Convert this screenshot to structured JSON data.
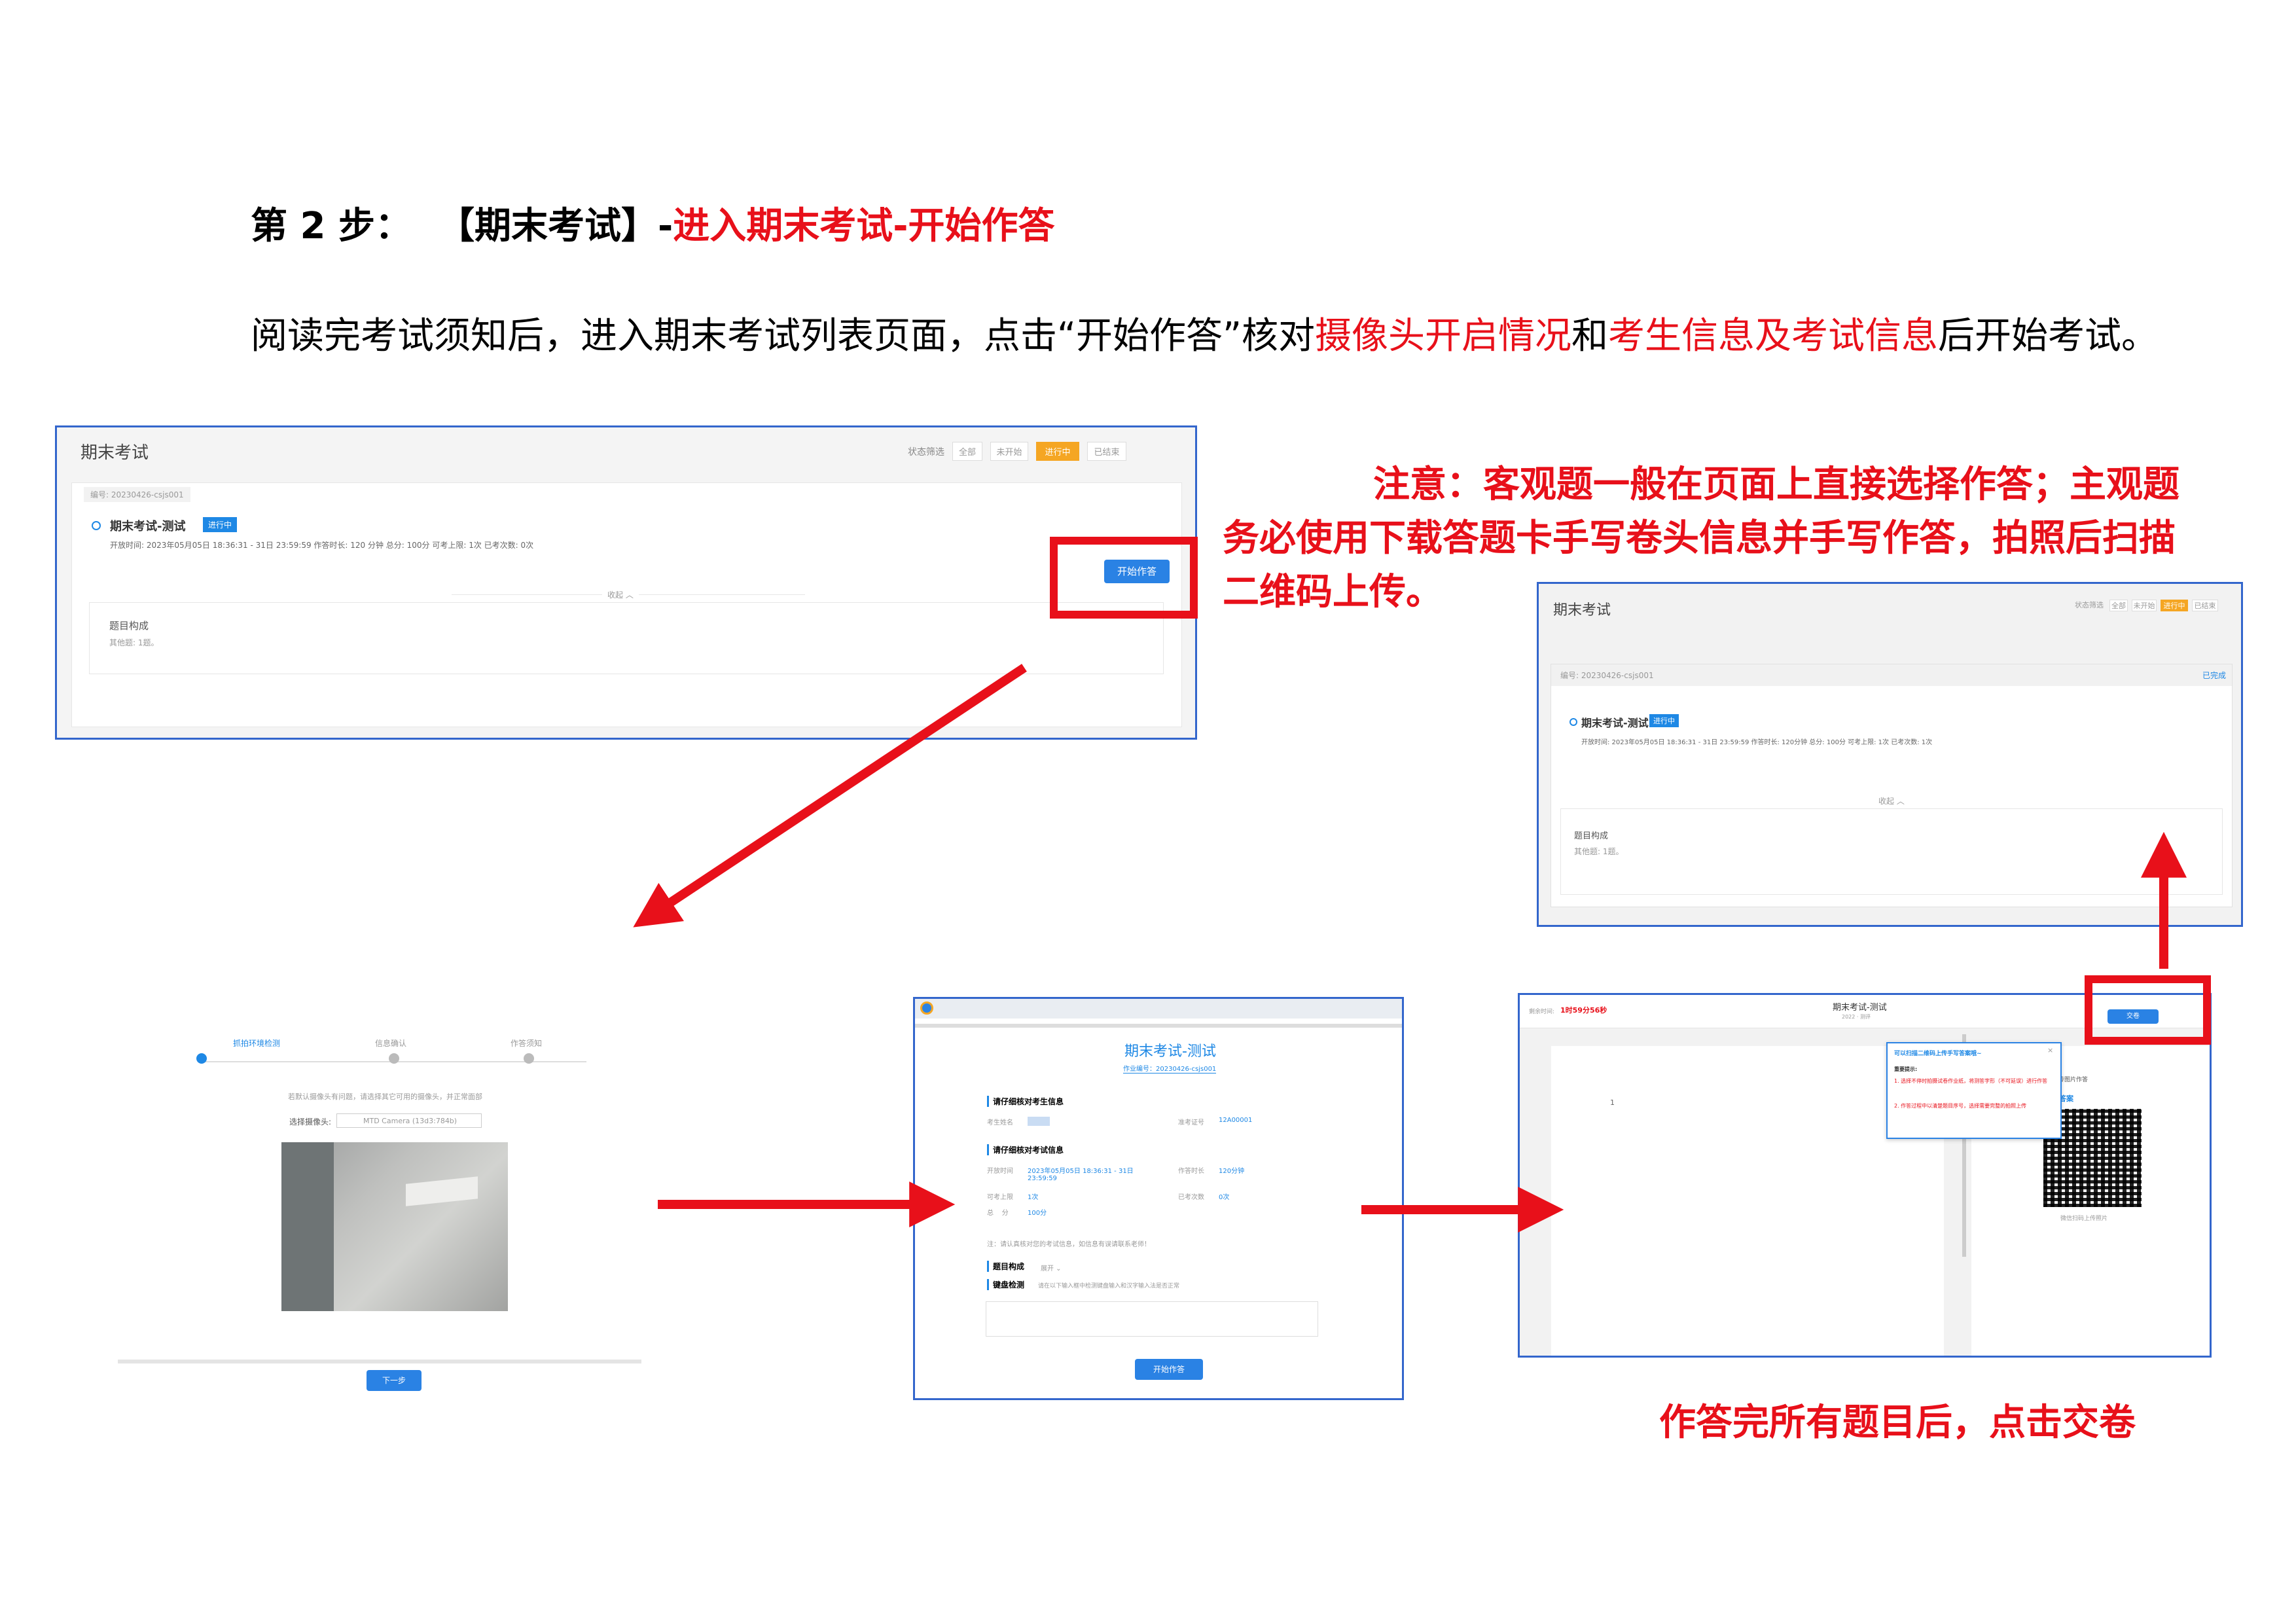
{
  "heading": {
    "step": "第 2 步：",
    "bracket": "【期末考试】-",
    "title": "进入期末考试-开始作答"
  },
  "intro": {
    "part1": "阅读完考试须知后，进入期末考试列表页面，点击“开始作答”核对",
    "red1": "摄像头开启情况",
    "part2": "和",
    "red2": "考生信息及考试信息",
    "part3": "后开始考试。"
  },
  "note": "注意：客观题一般在页面上直接选择作答；主观题务必使用下载答题卡手写卷头信息并手写作答，拍照后扫描二维码上传。",
  "bottom_note": "作答完所有题目后，点击交卷",
  "list_screen": {
    "title": "期末考试",
    "filter_label": "状态筛选",
    "filters": [
      "全部",
      "未开始",
      "进行中",
      "已结束"
    ],
    "code": "编号: 20230426-csjs001",
    "exam_name": "期末考试-测试",
    "status": "进行中",
    "details": "开放时间: 2023年05月05日 18:36:31 - 31日 23:59:59  作答时长: 120 分钟  总分: 100分    可考上限: 1次  已考次数: 0次",
    "start_btn": "开始作答",
    "collapse": "收起 ︿",
    "composition_title": "题目构成",
    "composition_item": "其他题: 1题。"
  },
  "camera_screen": {
    "steps": [
      "抓拍环境检测",
      "信息确认",
      "作答须知"
    ],
    "hint": "若默认摄像头有问题，请选择其它可用的摄像头，并正常面部",
    "select_label": "选择摄像头:",
    "select_value": "MTD Camera (13d3:784b)",
    "next_btn": "下一步"
  },
  "info_screen": {
    "title": "期末考试-测试",
    "subtitle": "作业编号：20230426-csjs001",
    "section1": "请仔细核对考生信息",
    "name_label": "考生姓名",
    "id_label": "准考证号",
    "id_value": "12A00001",
    "section2": "请仔细核对考试信息",
    "open_label": "开放时间",
    "open_value": "2023年05月05日 18:36:31 - 31日 23:59:59",
    "duration_label": "作答时长",
    "duration_value": "120分钟",
    "limit_label": "可考上限",
    "limit_value": "1次",
    "count_label": "已考次数",
    "count_value": "0次",
    "score_label": "总    分",
    "score_value": "100分",
    "notice": "注：请认真核对您的考试信息，如信息有误请联系老师！",
    "section3": "题目构成",
    "expand": "展开 ⌄",
    "section4": "键盘检测",
    "keyboard_hint": "请在以下输入框中检测键盘输入和汉字输入法是否正常",
    "start_btn": "开始作答"
  },
  "answer_screen": {
    "timer_label": "剩余时间:",
    "timer": "1时59分56秒",
    "title": "期末考试-测试",
    "subtitle": "2022 · 测评",
    "submit_btn": "交卷",
    "question_no": "1",
    "popup_title": "可以扫描二维码上传手写答案哦~",
    "popup_tip": "重要提示:",
    "popup_line1": "1. 选择不停时拍摄试卷作业纸，将测答字形（不可延误）进行作答",
    "popup_line2": "2. 作答过程中以清楚题目序号，选择需要完整的拍照上传",
    "upload_title": "上传答案",
    "side_label": "上传图片作答",
    "qr_caption": "微信扫码上传照片"
  },
  "list_screen2": {
    "title": "期末考试",
    "filters": [
      "状态筛选",
      "全部",
      "未开始",
      "进行中",
      "已结束"
    ],
    "code": "编号: 20230426-csjs001",
    "exam_name": "期末考试-测试",
    "status": "进行中",
    "right_tag": "已完成",
    "details": "开放时间: 2023年05月05日 18:36:31 - 31日 23:59:59  作答时长: 120分钟  总分: 100分    可考上限: 1次  已考次数: 1次",
    "collapse": "收起 ︿",
    "composition_title": "题目构成",
    "composition_item": "其他题: 1题。"
  },
  "colors": {
    "accent_red": "#e8101a",
    "frame_blue": "#3366cc",
    "button_blue": "#2a82e4",
    "status_orange": "#f5a623"
  }
}
